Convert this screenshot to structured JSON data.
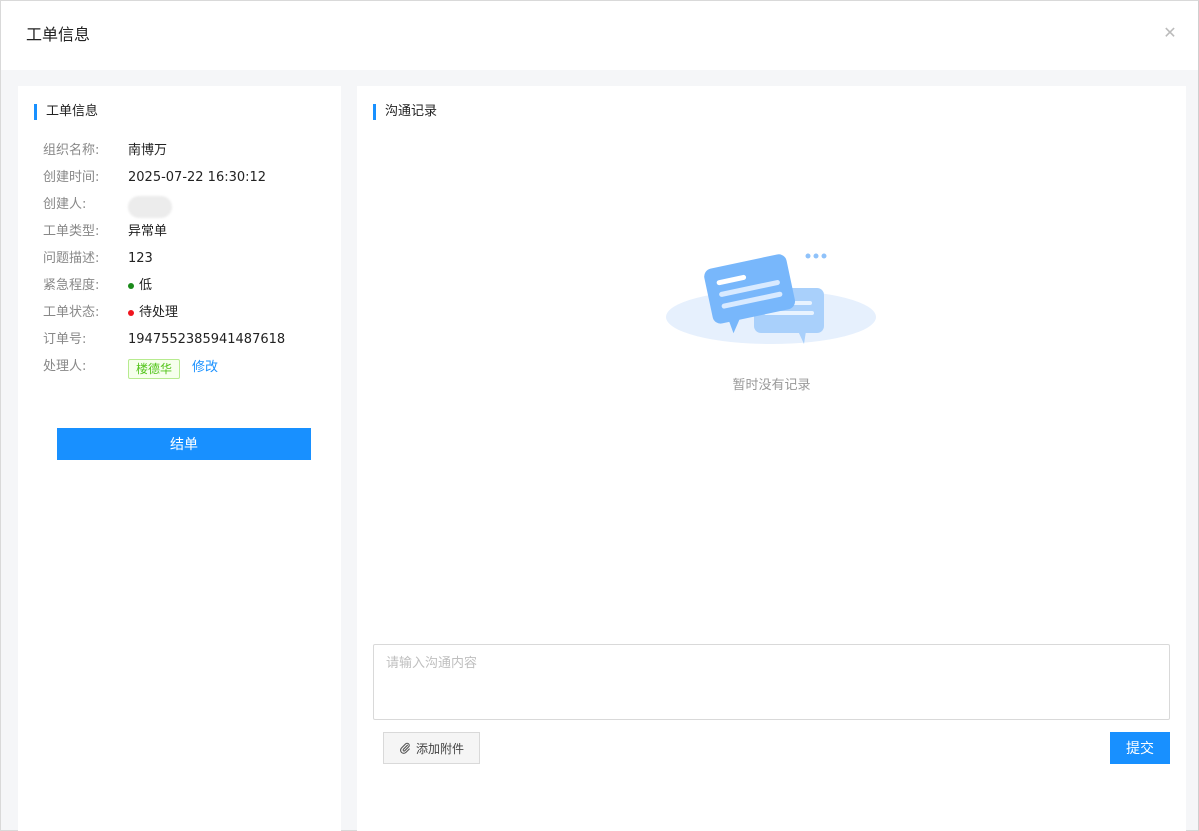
{
  "dialog": {
    "title": "工单信息",
    "close_icon": "close-icon"
  },
  "left": {
    "section_title": "工单信息",
    "fields": {
      "org_label": "组织名称:",
      "org_value": "南博万",
      "created_label": "创建时间:",
      "created_value": "2025-07-22 16:30:12",
      "creator_label": "创建人:",
      "type_label": "工单类型:",
      "type_value": "异常单",
      "desc_label": "问题描述:",
      "desc_value": "123",
      "urgency_label": "紧急程度:",
      "urgency_value": "低",
      "urgency_color": "#1a8a1a",
      "status_label": "工单状态:",
      "status_value": "待处理",
      "status_color": "#f0141e",
      "order_label": "订单号:",
      "order_value": "1947552385941487618",
      "handler_label": "处理人:",
      "handler_value": "楼德华",
      "handler_edit": "修改"
    },
    "close_button": "结单"
  },
  "right": {
    "section_title": "沟通记录",
    "empty_text": "暂时没有记录",
    "input_placeholder": "请输入沟通内容",
    "attach_label": "添加附件",
    "attach_icon": "paperclip-icon",
    "submit_label": "提交"
  },
  "colors": {
    "accent": "#1890ff"
  }
}
